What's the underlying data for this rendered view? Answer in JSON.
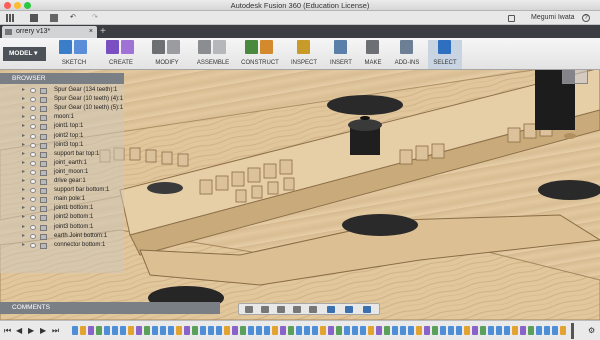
{
  "window": {
    "title": "Autodesk Fusion 360 (Education License)"
  },
  "app_toolbar": {
    "user": "Megumi Iwata",
    "help_glyph": "?"
  },
  "tabs": [
    {
      "label": "orrery v13*"
    }
  ],
  "tab_add": "+",
  "workspace": {
    "label": "MODEL"
  },
  "ribbon": [
    {
      "label": "SKETCH",
      "icons": [
        "sketch-arc-icon",
        "sketch-rect-icon"
      ],
      "colors": [
        "#3a7ec9",
        "#5b8ed8"
      ]
    },
    {
      "label": "CREATE",
      "icons": [
        "box-icon",
        "pattern-icon"
      ],
      "colors": [
        "#7a4fc2",
        "#a072d6"
      ]
    },
    {
      "label": "MODIFY",
      "icons": [
        "pushpull-icon",
        "fillet-icon"
      ],
      "colors": [
        "#6d6f73",
        "#9a9ca0"
      ]
    },
    {
      "label": "ASSEMBLE",
      "icons": [
        "joint-icon",
        "component-icon"
      ],
      "colors": [
        "#8b8d91",
        "#b5b7bb"
      ]
    },
    {
      "label": "CONSTRUCT",
      "icons": [
        "plane-icon",
        "axis-icon"
      ],
      "colors": [
        "#4b8a3e",
        "#d28a2c"
      ]
    },
    {
      "label": "INSPECT",
      "icons": [
        "measure-icon"
      ],
      "colors": [
        "#c89a2a"
      ]
    },
    {
      "label": "INSERT",
      "icons": [
        "insert-image-icon"
      ],
      "colors": [
        "#5a7fa8"
      ]
    },
    {
      "label": "MAKE",
      "icons": [
        "make-print-icon"
      ],
      "colors": [
        "#6c6f74"
      ]
    },
    {
      "label": "ADD-INS",
      "icons": [
        "addin-icon"
      ],
      "colors": [
        "#6d7f95"
      ]
    },
    {
      "label": "SELECT",
      "icons": [
        "select-arrow-icon"
      ],
      "colors": [
        "#2f6fbf"
      ]
    }
  ],
  "browser": {
    "title": "BROWSER",
    "items": [
      "Spur Gear (134 teeth):1",
      "Spur Gear (10 teeth) (4):1",
      "Spur Gear (10 teeth) (5):1",
      "moon:1",
      "joint1 top:1",
      "joint2 top:1",
      "joint3 top:1",
      "support bar top:1",
      "joint_earth:1",
      "joint_moon:1",
      "drive gear:1",
      "support bar bottom:1",
      "main pole:1",
      "joint1 bottom:1",
      "joint2 bottom:1",
      "joint3 bottom:1",
      "earth Joint bottom:1",
      "connector bottom:1"
    ]
  },
  "comments": {
    "title": "COMMENTS"
  },
  "timeline": {
    "controls": [
      "⏮",
      "◀",
      "▶",
      "▶",
      "⏭"
    ]
  }
}
